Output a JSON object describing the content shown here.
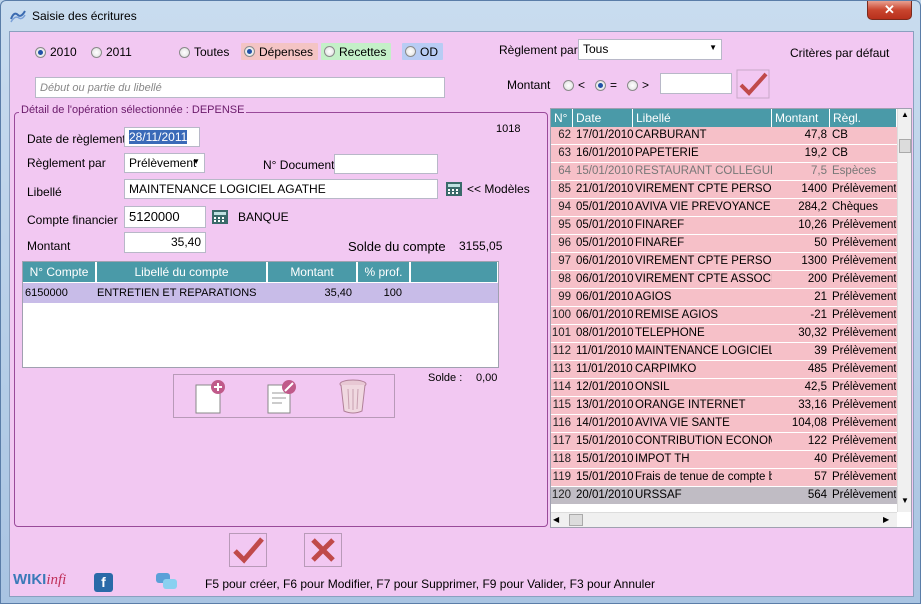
{
  "window": {
    "title": "Saisie des écritures",
    "close_label": "✕"
  },
  "filters": {
    "year_2010": "2010",
    "year_2011": "2011",
    "type_all": "Toutes",
    "type_expenses": "Dépenses",
    "type_income": "Recettes",
    "type_od": "OD",
    "payment_label": "Règlement par",
    "payment_value": "Tous",
    "default_criteria": "Critères par défaut",
    "label_search_placeholder": "Début ou partie du libellé",
    "amount_label": "Montant",
    "amount_lt": "<",
    "amount_eq": "=",
    "amount_gt": ">",
    "amount_value": ""
  },
  "detail": {
    "legend": "Détail de l'opération sélectionnée : DEPENSE",
    "id_number": "1018",
    "date_label": "Date de règlement",
    "date_value": "28/11/2011",
    "payment_label": "Règlement par",
    "payment_value": "Prélèvement",
    "doc_label": "N° Document",
    "doc_value": "",
    "label_label": "Libellé",
    "label_value": "MAINTENANCE LOGICIEL AGATHE",
    "models_link": "<< Modèles",
    "account_label": "Compte financier",
    "account_value": "5120000",
    "account_name": "BANQUE",
    "amount_label": "Montant",
    "amount_value": "35,40",
    "balance_label": "Solde du compte",
    "balance_value": "3155,05",
    "grid": {
      "headers": [
        "N° Compte",
        "Libellé du compte",
        "Montant",
        "% prof."
      ],
      "rows": [
        {
          "account": "6150000",
          "label": "ENTRETIEN ET REPARATIONS",
          "amount": "35,40",
          "pct": "100"
        }
      ]
    },
    "solde_label": "Solde :",
    "solde_value": "0,00"
  },
  "list": {
    "headers": [
      "N°",
      "Date",
      "Libellé",
      "Montant",
      "Règl."
    ],
    "rows": [
      {
        "n": "62",
        "date": "17/01/2010",
        "label": "CARBURANT",
        "amount": "47,8",
        "pay": "CB"
      },
      {
        "n": "63",
        "date": "16/01/2010",
        "label": "PAPETERIE",
        "amount": "19,2",
        "pay": "CB"
      },
      {
        "n": "64",
        "date": "15/01/2010",
        "label": "RESTAURANT COLLEGUE",
        "amount": "7,5",
        "pay": "Espèces"
      },
      {
        "n": "85",
        "date": "21/01/2010",
        "label": "VIREMENT CPTE PERSO",
        "amount": "1400",
        "pay": "Prélèvement"
      },
      {
        "n": "94",
        "date": "05/01/2010",
        "label": "AVIVA VIE PREVOYANCE",
        "amount": "284,2",
        "pay": "Chèques"
      },
      {
        "n": "95",
        "date": "05/01/2010",
        "label": "FINAREF",
        "amount": "10,26",
        "pay": "Prélèvement"
      },
      {
        "n": "96",
        "date": "05/01/2010",
        "label": "FINAREF",
        "amount": "50",
        "pay": "Prélèvement"
      },
      {
        "n": "97",
        "date": "06/01/2010",
        "label": "VIREMENT CPTE PERSO",
        "amount": "1300",
        "pay": "Prélèvement"
      },
      {
        "n": "98",
        "date": "06/01/2010",
        "label": "VIREMENT CPTE ASSOCIE",
        "amount": "200",
        "pay": "Prélèvement"
      },
      {
        "n": "99",
        "date": "06/01/2010",
        "label": "AGIOS",
        "amount": "21",
        "pay": "Prélèvement"
      },
      {
        "n": "100",
        "date": "06/01/2010",
        "label": "REMISE AGIOS",
        "amount": "-21",
        "pay": "Prélèvement"
      },
      {
        "n": "101",
        "date": "08/01/2010",
        "label": "TELEPHONE",
        "amount": "30,32",
        "pay": "Prélèvement"
      },
      {
        "n": "112",
        "date": "11/01/2010",
        "label": "MAINTENANCE LOGICIEL AG",
        "amount": "39",
        "pay": "Prélèvement"
      },
      {
        "n": "113",
        "date": "11/01/2010",
        "label": "CARPIMKO",
        "amount": "485",
        "pay": "Prélèvement"
      },
      {
        "n": "114",
        "date": "12/01/2010",
        "label": "ONSIL",
        "amount": "42,5",
        "pay": "Prélèvement"
      },
      {
        "n": "115",
        "date": "13/01/2010",
        "label": "ORANGE INTERNET",
        "amount": "33,16",
        "pay": "Prélèvement"
      },
      {
        "n": "116",
        "date": "14/01/2010",
        "label": "AVIVA VIE SANTE",
        "amount": "104,08",
        "pay": "Prélèvement"
      },
      {
        "n": "117",
        "date": "15/01/2010",
        "label": "CONTRIBUTION ECONOMIQ",
        "amount": "122",
        "pay": "Prélèvement"
      },
      {
        "n": "118",
        "date": "15/01/2010",
        "label": "IMPOT TH",
        "amount": "40",
        "pay": "Prélèvement"
      },
      {
        "n": "119",
        "date": "15/01/2010",
        "label": "Frais de tenue de compte ba",
        "amount": "57",
        "pay": "Prélèvement"
      },
      {
        "n": "120",
        "date": "20/01/2010",
        "label": "URSSAF",
        "amount": "564",
        "pay": "Prélèvement"
      }
    ]
  },
  "footer": {
    "brand_wiki": "WIKI",
    "brand_infi": "infi",
    "shortcuts": "F5 pour créer, F6 pour Modifier, F7 pour Supprimer, F9 pour Valider, F3 pour Annuler"
  },
  "colors": {
    "accent": "#4a9aa8",
    "background": "#f2c8f2",
    "row_pink": "#f6c0c8",
    "row_selected": "#c0bcc4"
  }
}
